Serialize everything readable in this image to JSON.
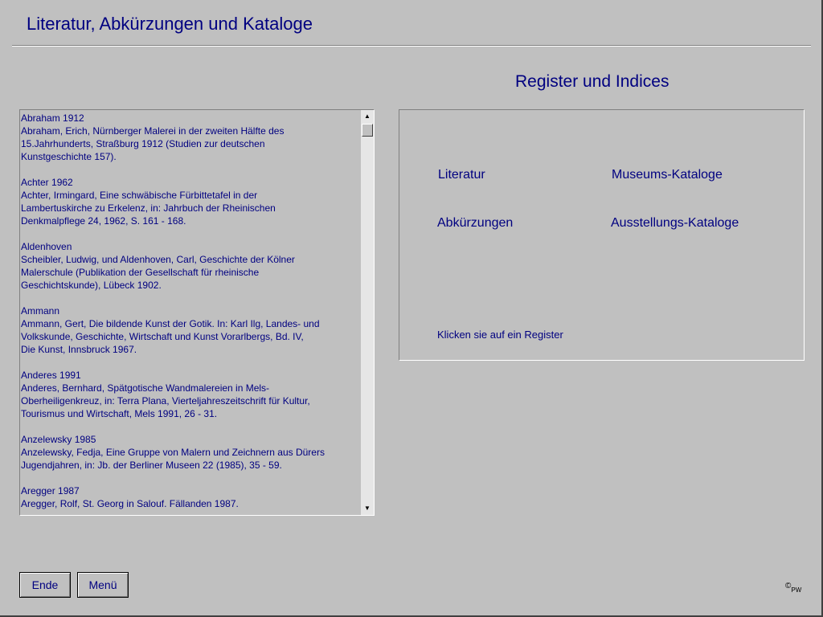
{
  "header": {
    "title": "Literatur, Abkürzungen und Kataloge"
  },
  "literature": {
    "entries": [
      {
        "lines": [
          "Abraham 1912",
          "Abraham, Erich, Nürnberger Malerei in der zweiten Hälfte des",
          "15.Jahrhunderts, Straßburg 1912 (Studien zur deutschen",
          "Kunstgeschichte 157)."
        ]
      },
      {
        "lines": [
          "Achter 1962",
          "Achter, Irmingard, Eine schwäbische Fürbittetafel in der",
          "Lambertuskirche zu Erkelenz, in: Jahrbuch der Rheinischen",
          "Denkmalpflege 24, 1962, S. 161 - 168."
        ]
      },
      {
        "lines": [
          "Aldenhoven",
          "Scheibler, Ludwig, und Aldenhoven, Carl, Geschichte der Kölner",
          "Malerschule (Publikation der Gesellschaft für rheinische",
          "Geschichtskunde), Lübeck 1902."
        ]
      },
      {
        "lines": [
          "Ammann",
          "Ammann, Gert, Die bildende Kunst der Gotik. In: Karl Ilg, Landes- und",
          "Volkskunde, Geschichte, Wirtschaft und Kunst Vorarlbergs, Bd. IV,",
          "Die Kunst, Innsbruck 1967."
        ]
      },
      {
        "lines": [
          "Anderes 1991",
          "Anderes, Bernhard, Spätgotische Wandmalereien in Mels-",
          "Oberheiligenkreuz, in: Terra Plana, Vierteljahreszeitschrift für Kultur,",
          "Tourismus und Wirtschaft, Mels 1991, 26 - 31."
        ]
      },
      {
        "lines": [
          "Anzelewsky 1985",
          "Anzelewsky, Fedja, Eine Gruppe von Malern und Zeichnern aus Dürers",
          "Jugendjahren, in: Jb. der Berliner Museen 22 (1985), 35 - 59."
        ]
      },
      {
        "lines": [
          "Aregger 1987",
          "Aregger, Rolf, St. Georg in Salouf. Fällanden 1987."
        ]
      }
    ],
    "scroll_up_icon": "triangle-up-icon",
    "scroll_down_icon": "triangle-down-icon"
  },
  "registers": {
    "heading": "Register und Indices",
    "links": {
      "literatur": "Literatur",
      "museums": "Museums-Kataloge",
      "abkuerzungen": "Abkürzungen",
      "ausstellungs": "Ausstellungs-Kataloge"
    },
    "hint": "Klicken sie auf ein Register"
  },
  "buttons": {
    "ende": "Ende",
    "menu": "Menü"
  },
  "footer": {
    "copyright_symbol": "©",
    "copyright_initials": "PW"
  },
  "colors": {
    "background": "#c0c0c0",
    "text": "#000080"
  }
}
